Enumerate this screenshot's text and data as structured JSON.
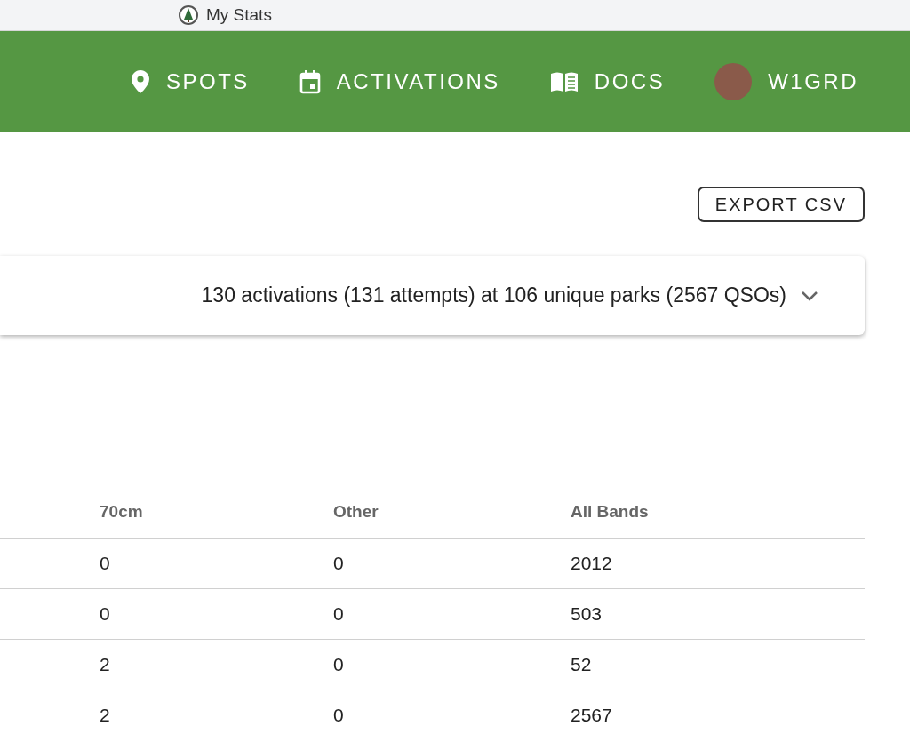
{
  "browser_tab": {
    "title": "My Stats"
  },
  "nav": {
    "items": [
      {
        "kind": "pin",
        "label": "SPOTS"
      },
      {
        "kind": "calendar",
        "label": "ACTIVATIONS"
      },
      {
        "kind": "book",
        "label": "DOCS"
      },
      {
        "kind": "avatar",
        "label": "W1GRD"
      }
    ]
  },
  "export_button": "EXPORT CSV",
  "summary_panel": {
    "text": "130 activations (131 attempts) at 106 unique parks (2567 QSOs)",
    "expanded": false
  },
  "table": {
    "columns": [
      "70cm",
      "Other",
      "All Bands"
    ],
    "rows": [
      [
        "0",
        "0",
        "2012"
      ],
      [
        "0",
        "0",
        "503"
      ],
      [
        "2",
        "0",
        "52"
      ],
      [
        "2",
        "0",
        "2567"
      ]
    ]
  }
}
